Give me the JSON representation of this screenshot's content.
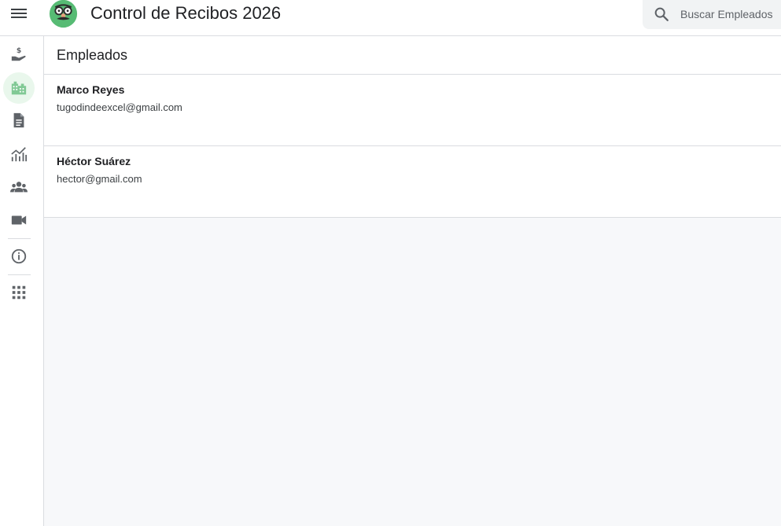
{
  "app": {
    "title": "Control de Recibos 2026"
  },
  "search": {
    "placeholder": "Buscar Empleados"
  },
  "colors": {
    "accent": "#57bb74",
    "icon": "#5f6368"
  },
  "sidebar": {
    "items": [
      {
        "icon": "payment-hand-icon",
        "active": false
      },
      {
        "icon": "building-icon",
        "active": true
      },
      {
        "icon": "document-icon",
        "active": false
      },
      {
        "icon": "chart-icon",
        "active": false
      },
      {
        "icon": "people-icon",
        "active": false
      },
      {
        "icon": "video-icon",
        "active": false
      },
      {
        "icon": "info-icon",
        "active": false
      },
      {
        "icon": "apps-grid-icon",
        "active": false
      }
    ]
  },
  "main": {
    "title": "Empleados",
    "employees": [
      {
        "name": "Marco Reyes",
        "email": "tugodindeexcel@gmail.com"
      },
      {
        "name": "Héctor Suárez",
        "email": "hector@gmail.com"
      }
    ]
  }
}
